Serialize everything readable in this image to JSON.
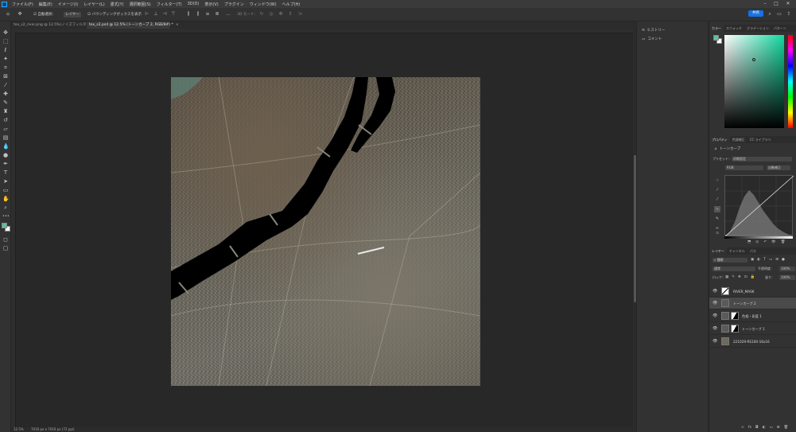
{
  "menu": {
    "items": [
      "ファイル(F)",
      "編集(E)",
      "イメージ(I)",
      "レイヤー(L)",
      "書式(Y)",
      "選択範囲(S)",
      "フィルター(T)",
      "3D(D)",
      "表示(V)",
      "プラグイン",
      "ウィンドウ(W)",
      "ヘルプ(H)"
    ]
  },
  "options_bar": {
    "auto_select_label": "自動選択：",
    "auto_select_target": "レイヤー",
    "show_transform_label": "バウンディングボックスを表示",
    "mode_3d_label": "3D モード：",
    "share_label": "共有"
  },
  "tabs": [
    {
      "label": "tex_s2_river.png @ 12.5%(ノイズフィルタ)",
      "active": false
    },
    {
      "label": "tex_s2.psd @ 12.5% (トーンカーブ 2, RGB/8#) *",
      "active": true
    }
  ],
  "status": {
    "zoom": "12.5%",
    "doc_size": "7016 px x 7016 px (72 ppi)"
  },
  "history_panel": {
    "items": [
      {
        "label": "ヒストリー",
        "icon": "history-icon"
      },
      {
        "label": "コメント",
        "icon": "comment-icon"
      }
    ]
  },
  "color_panel": {
    "tabs": [
      "カラー",
      "スウォッチ",
      "グラデーション",
      "パターン"
    ],
    "foreground": "#5fbfa0",
    "background": "#ffffff"
  },
  "properties_panel": {
    "tabs": [
      "プロパティ",
      "色調補正",
      "CC ライブラリ"
    ],
    "adjustment_label": "トーンカーブ",
    "preset_label": "プリセット：",
    "preset_value": "初期設定",
    "channel_value": "RGB",
    "auto_label": "自動補正"
  },
  "layers_panel": {
    "tabs": [
      "レイヤー",
      "チャンネル",
      "パス"
    ],
    "filter_label": "種類",
    "blend_mode": "通常",
    "opacity_label": "不透明度：",
    "opacity_value": "100%",
    "lock_label": "ロック：",
    "fill_label": "塗り：",
    "fill_value": "100%",
    "layers": [
      {
        "name": "RIVER_MASK",
        "selected": false,
        "type": "pixel"
      },
      {
        "name": "トーンカーブ 2",
        "selected": true,
        "type": "adjustment"
      },
      {
        "name": "色相・彩度 1",
        "selected": false,
        "type": "adjustment-mask"
      },
      {
        "name": "トーンカーブ 1",
        "selected": false,
        "type": "adjustment-mask"
      },
      {
        "name": "221029-RS100-16x16",
        "selected": false,
        "type": "image"
      }
    ]
  }
}
